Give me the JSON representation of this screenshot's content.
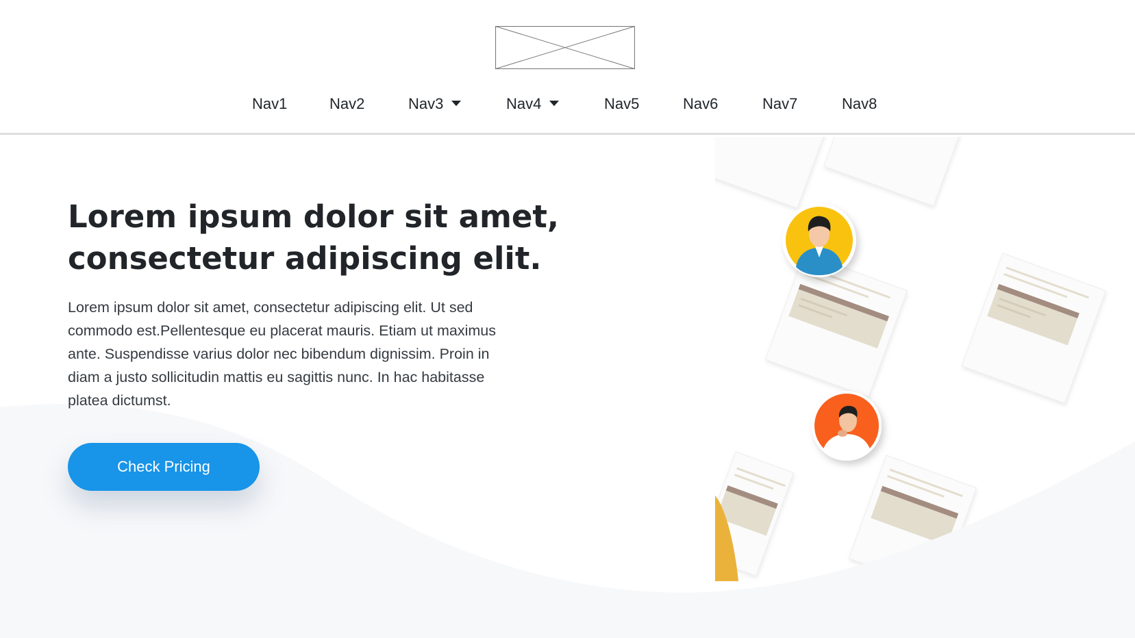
{
  "nav": {
    "items": [
      {
        "label": "Nav1",
        "dropdown": false
      },
      {
        "label": "Nav2",
        "dropdown": false
      },
      {
        "label": "Nav3",
        "dropdown": true
      },
      {
        "label": "Nav4",
        "dropdown": true
      },
      {
        "label": "Nav5",
        "dropdown": false
      },
      {
        "label": "Nav6",
        "dropdown": false
      },
      {
        "label": "Nav7",
        "dropdown": false
      },
      {
        "label": "Nav8",
        "dropdown": false
      }
    ]
  },
  "hero": {
    "title": "Lorem ipsum dolor sit amet, consectetur adipiscing elit.",
    "description": "Lorem ipsum dolor sit amet, consectetur adipiscing elit. Ut sed commodo est.Pellentesque eu placerat mauris. Etiam ut maximus ante. Suspendisse varius dolor nec bibendum dignissim. Proin in diam a justo sollicitudin mattis eu sagittis nunc. In hac habitasse platea dictumst.",
    "cta_label": "Check Pricing"
  },
  "colors": {
    "accent": "#1894e8",
    "avatar_yellow": "#f9c20f",
    "avatar_orange": "#f9601e",
    "wave": "#f7f8fa"
  },
  "icons": {
    "logo": "image-placeholder-icon",
    "dropdown": "caret-down-icon"
  }
}
